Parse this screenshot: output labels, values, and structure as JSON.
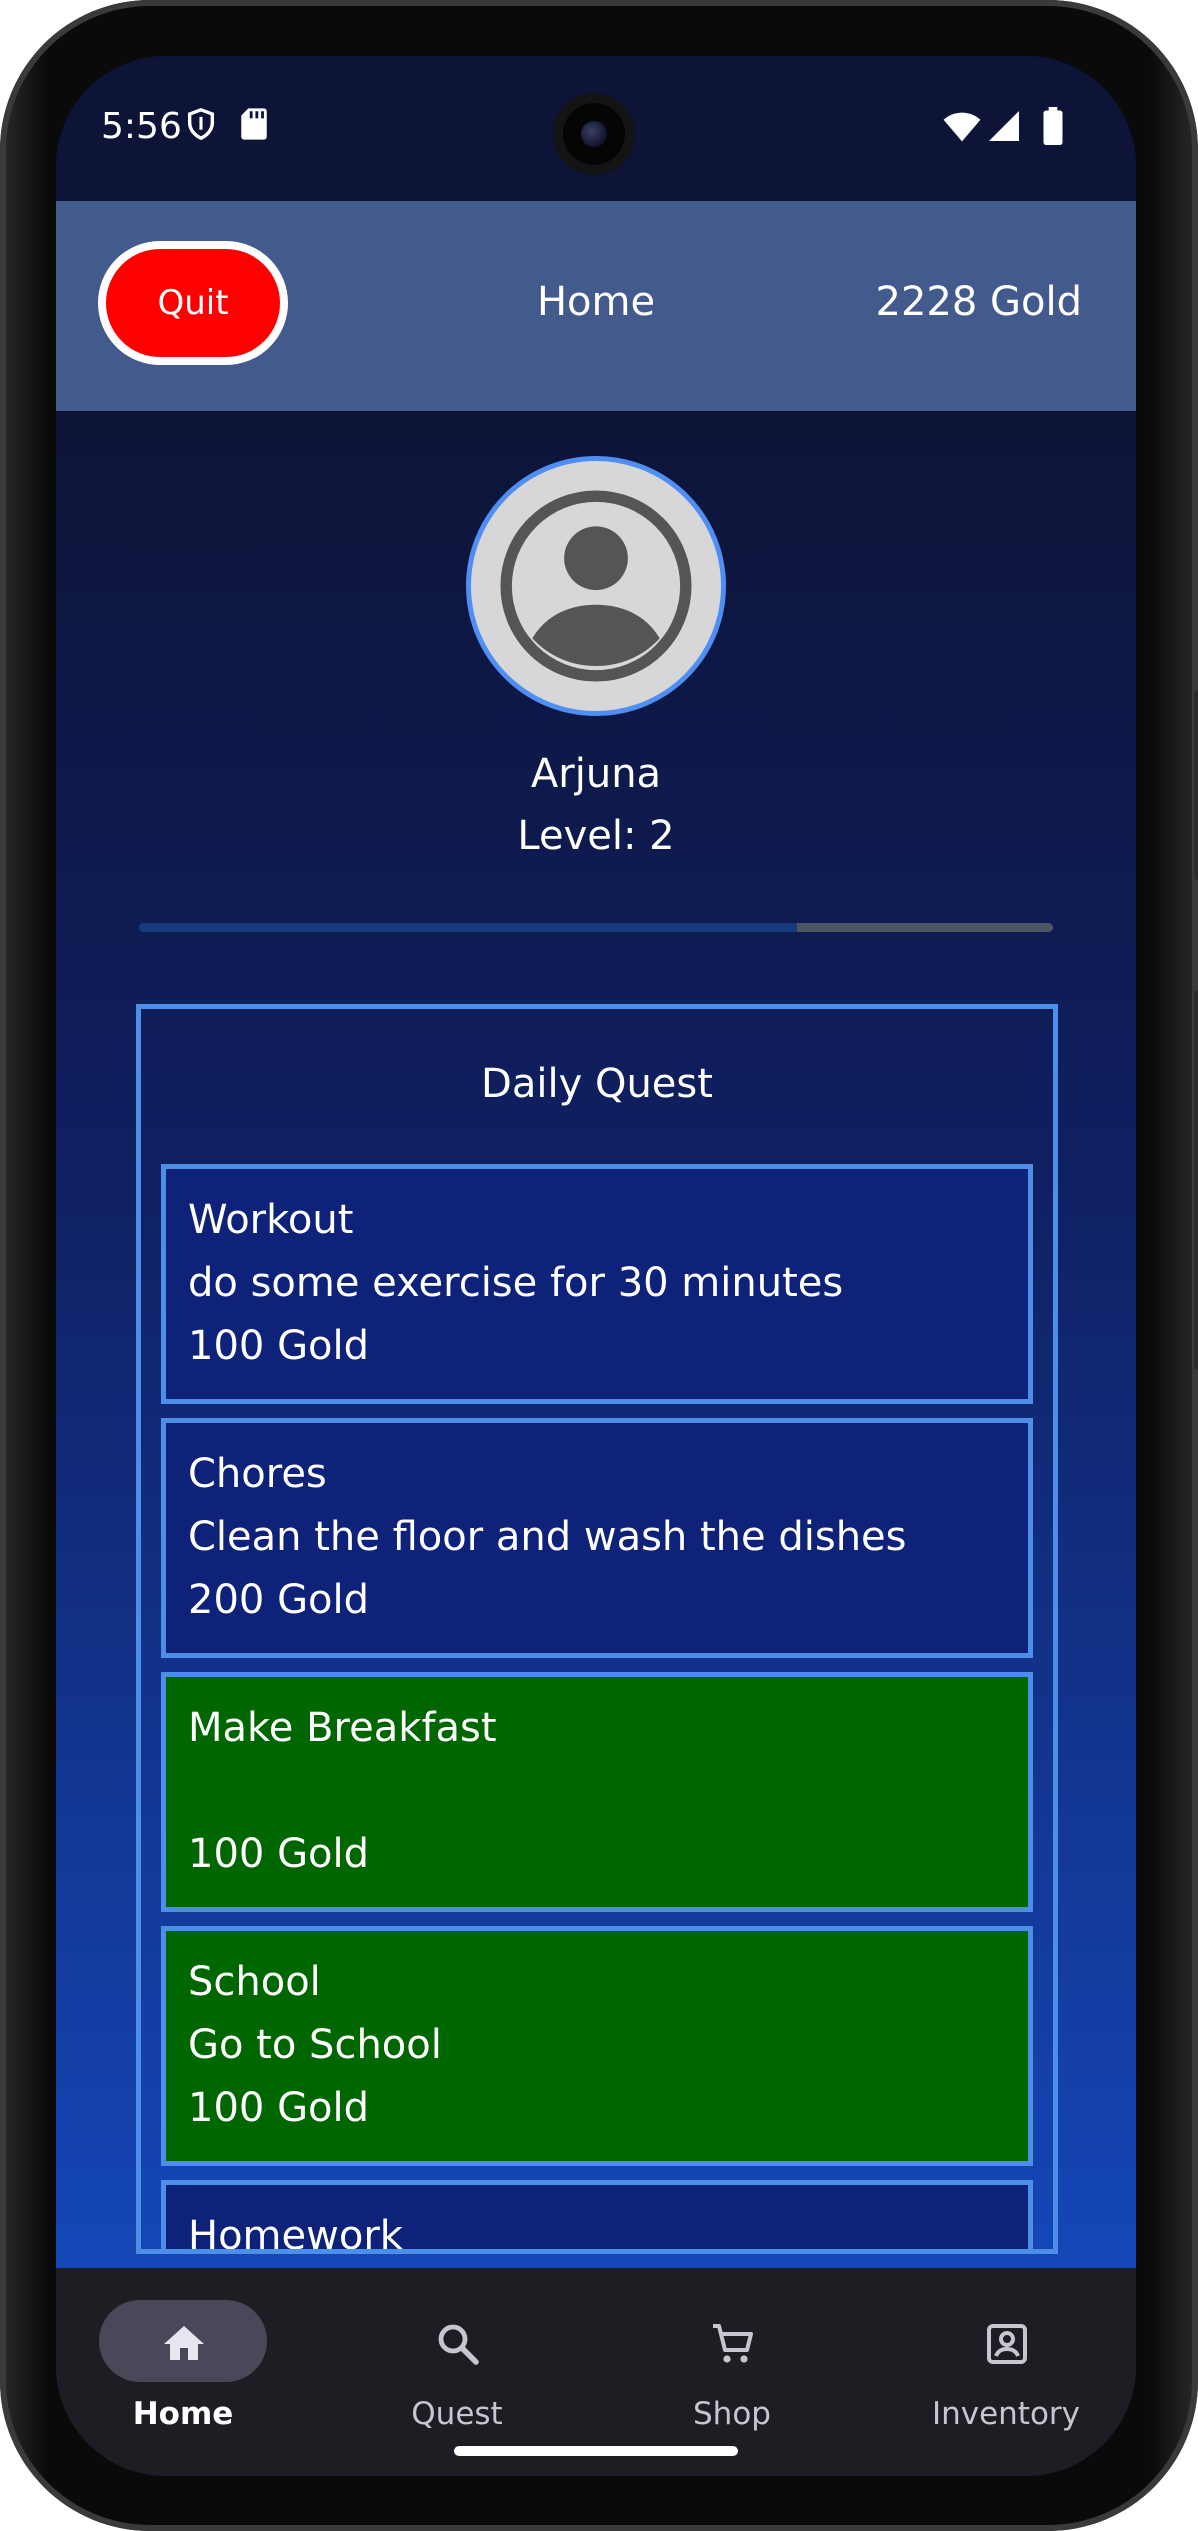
{
  "status_bar": {
    "time": "5:56"
  },
  "header": {
    "quit_label": "Quit",
    "title": "Home",
    "gold": "2228 Gold"
  },
  "profile": {
    "name": "Arjuna",
    "level": "Level: 2",
    "xp_fraction": 0.72
  },
  "daily_quest": {
    "heading": "Daily Quest",
    "quests": [
      {
        "title": "Workout",
        "description": "do some exercise for 30 minutes",
        "reward": "100 Gold",
        "completed": false
      },
      {
        "title": "Chores",
        "description": "Clean the floor and wash the dishes",
        "reward": "200 Gold",
        "completed": false
      },
      {
        "title": "Make Breakfast",
        "description": "",
        "reward": "100 Gold",
        "completed": true
      },
      {
        "title": "School",
        "description": "Go to School",
        "reward": "100 Gold",
        "completed": true
      },
      {
        "title": "Homework",
        "description": "",
        "reward": "",
        "completed": false
      }
    ]
  },
  "bottom_nav": {
    "items": [
      {
        "label": "Home",
        "icon": "home-icon",
        "active": true
      },
      {
        "label": "Quest",
        "icon": "search-icon",
        "active": false
      },
      {
        "label": "Shop",
        "icon": "cart-icon",
        "active": false
      },
      {
        "label": "Inventory",
        "icon": "account-box-icon",
        "active": false
      }
    ]
  },
  "colors": {
    "quit_button": "#fe0000",
    "appbar": "#425a8c",
    "quest_card": "#0d2278",
    "quest_completed": "#006600",
    "border_accent": "#4d8ee8"
  }
}
